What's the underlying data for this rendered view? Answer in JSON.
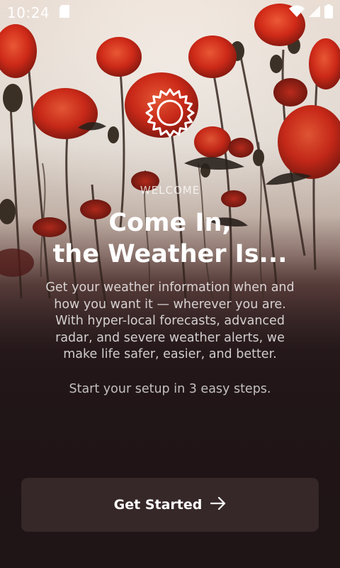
{
  "status_bar": {
    "time": "10:24",
    "left_icons": [
      "sd-card-icon"
    ],
    "right_icons": [
      "wifi-icon",
      "cell-signal-icon",
      "battery-icon"
    ]
  },
  "hero": {
    "icon": "sun-icon",
    "eyebrow": "WELCOME",
    "title_line1": "Come In,",
    "title_line2": "the Weather Is...",
    "description": "Get your weather information when and how you want it — wherever you are. With hyper-local forecasts, advanced radar, and severe weather alerts, we make life safer, easier, and better.",
    "steps": "Start your setup in 3 easy steps."
  },
  "cta": {
    "label": "Get Started",
    "icon": "arrow-right-icon"
  },
  "colors": {
    "background_dark": "#1f1416",
    "poppy_red": "#d8301c",
    "button_bg": "#362728"
  }
}
